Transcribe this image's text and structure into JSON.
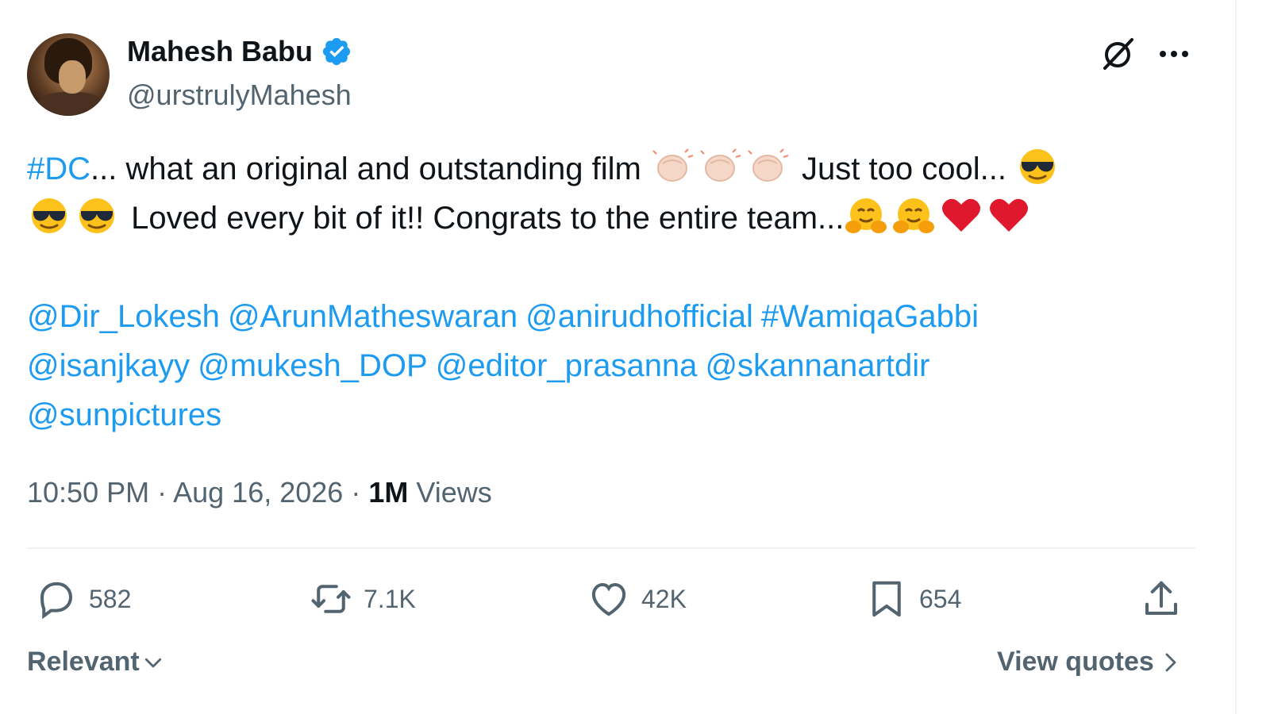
{
  "author": {
    "display_name": "Mahesh Babu",
    "handle": "@urstrulyMahesh",
    "verified": true
  },
  "tweet": {
    "hashtag_dc": "#DC",
    "line1_text": "... what an original and outstanding film",
    "line1_after_claps": "Just too cool...",
    "line2_text": "Loved every bit of it!! Congrats to the entire team...",
    "emojis_line1": [
      "clapping-hands",
      "clapping-hands",
      "clapping-hands",
      "smiling-face-with-sunglasses"
    ],
    "emojis_line2_start": [
      "smiling-face-with-sunglasses",
      "smiling-face-with-sunglasses"
    ],
    "emojis_line2_end": [
      "hugging-face",
      "hugging-face",
      "red-heart",
      "red-heart"
    ],
    "mentions_row1": [
      "@Dir_Lokesh",
      "@ArunMatheswaran",
      "@anirudhofficial",
      "#WamiqaGabbi"
    ],
    "mentions_row2": [
      "@isanjkayy",
      "@mukesh_DOP",
      "@editor_prasanna",
      "@skannanartdir"
    ],
    "mentions_row3": [
      "@sunpictures"
    ]
  },
  "meta": {
    "time": "10:50 PM",
    "separator": "·",
    "date": "Aug 16, 2026",
    "views_count": "1M",
    "views_label": "Views"
  },
  "actions": {
    "replies": "582",
    "reposts": "7.1K",
    "likes": "42K",
    "bookmarks": "654"
  },
  "footer": {
    "sort_label": "Relevant",
    "view_quotes_label": "View quotes"
  },
  "colors": {
    "link": "#1d9bf0",
    "text": "#0f1419",
    "secondary": "#536471",
    "divider": "#eff3f4"
  }
}
